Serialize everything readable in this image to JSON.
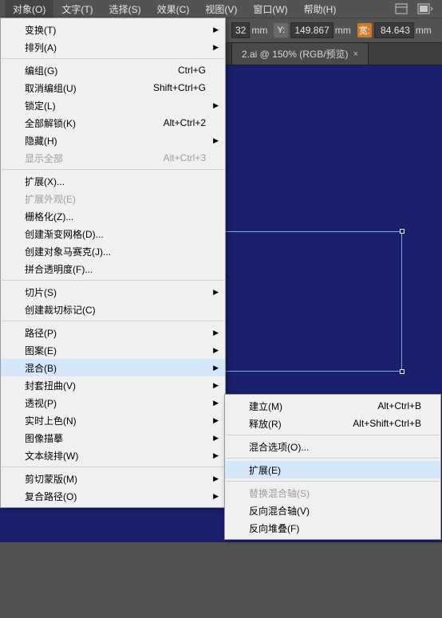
{
  "menubar": {
    "items": [
      "对象(O)",
      "文字(T)",
      "选择(S)",
      "效果(C)",
      "视图(V)",
      "窗口(W)",
      "帮助(H)"
    ]
  },
  "toolbar": {
    "mmSuffix": "mm",
    "y_label": "Y:",
    "y_value": "149.867",
    "w_label": "宽:",
    "w_value": "84.643",
    "x_frag": "32"
  },
  "tab": {
    "title": "2.ai @ 150% (RGB/预览)",
    "close": "×"
  },
  "menu": {
    "transform": "变换(T)",
    "arrange": "排列(A)",
    "group": "编组(G)",
    "group_sc": "Ctrl+G",
    "ungroup": "取消编组(U)",
    "ungroup_sc": "Shift+Ctrl+G",
    "lock": "锁定(L)",
    "unlockAll": "全部解锁(K)",
    "unlockAll_sc": "Alt+Ctrl+2",
    "hide": "隐藏(H)",
    "showAll": "显示全部",
    "showAll_sc": "Alt+Ctrl+3",
    "expand": "扩展(X)...",
    "expandAppearance": "扩展外观(E)",
    "rasterize": "栅格化(Z)...",
    "gradientMesh": "创建渐变网格(D)...",
    "mosaic": "创建对象马赛克(J)...",
    "flatten": "拼合透明度(F)...",
    "slice": "切片(S)",
    "cropMarks": "创建裁切标记(C)",
    "path": "路径(P)",
    "pattern": "图案(E)",
    "blend": "混合(B)",
    "envelope": "封套扭曲(V)",
    "perspective": "透视(P)",
    "livePaint": "实时上色(N)",
    "imageTrace": "图像描摹",
    "textWrap": "文本绕排(W)",
    "clippingMask": "剪切蒙版(M)",
    "compoundPath": "复合路径(O)"
  },
  "submenu": {
    "make": "建立(M)",
    "make_sc": "Alt+Ctrl+B",
    "release": "释放(R)",
    "release_sc": "Alt+Shift+Ctrl+B",
    "options": "混合选项(O)...",
    "expand": "扩展(E)",
    "replaceSpine": "替换混合轴(S)",
    "reverseSpine": "反向混合轴(V)",
    "reverseFront": "反向堆叠(F)"
  }
}
